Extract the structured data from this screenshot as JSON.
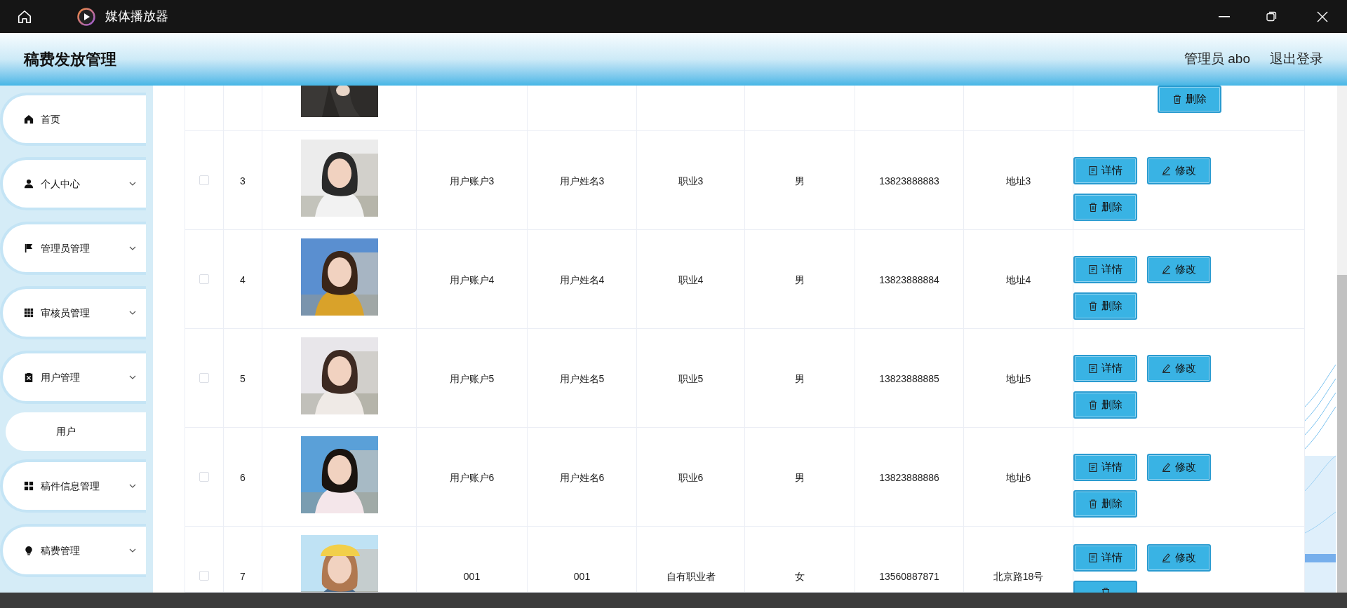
{
  "player": {
    "title": "媒体播放器"
  },
  "app": {
    "title": "稿费发放管理",
    "user": "管理员 abo",
    "logout": "退出登录"
  },
  "sidebar": {
    "items": [
      {
        "label": "首页",
        "kind": "home",
        "expandable": false
      },
      {
        "label": "个人中心",
        "kind": "person",
        "expandable": true
      },
      {
        "label": "管理员管理",
        "kind": "flag",
        "expandable": true
      },
      {
        "label": "审核员管理",
        "kind": "grid9",
        "expandable": true
      },
      {
        "label": "用户管理",
        "kind": "clipboard",
        "expandable": true,
        "children": [
          {
            "label": "用户"
          }
        ]
      },
      {
        "label": "稿件信息管理",
        "kind": "grid4",
        "expandable": true
      },
      {
        "label": "稿费管理",
        "kind": "bulb",
        "expandable": true
      }
    ]
  },
  "table": {
    "rows": [
      {
        "partial": true,
        "actions": [
          {
            "kind": "delete",
            "label": "删除"
          }
        ]
      },
      {
        "checked": false,
        "index": "3",
        "account": "用户账户3",
        "name": "用户姓名3",
        "job": "职业3",
        "gender": "男",
        "phone": "13823888883",
        "address": "地址3",
        "actions": [
          {
            "kind": "detail",
            "label": "详情"
          },
          {
            "kind": "edit",
            "label": "修改"
          },
          {
            "kind": "delete",
            "label": "删除"
          }
        ]
      },
      {
        "checked": false,
        "index": "4",
        "account": "用户账户4",
        "name": "用户姓名4",
        "job": "职业4",
        "gender": "男",
        "phone": "13823888884",
        "address": "地址4",
        "actions": [
          {
            "kind": "detail",
            "label": "详情"
          },
          {
            "kind": "edit",
            "label": "修改"
          },
          {
            "kind": "delete",
            "label": "删除"
          }
        ]
      },
      {
        "checked": false,
        "index": "5",
        "account": "用户账户5",
        "name": "用户姓名5",
        "job": "职业5",
        "gender": "男",
        "phone": "13823888885",
        "address": "地址5",
        "actions": [
          {
            "kind": "detail",
            "label": "详情"
          },
          {
            "kind": "edit",
            "label": "修改"
          },
          {
            "kind": "delete",
            "label": "删除"
          }
        ]
      },
      {
        "checked": false,
        "index": "6",
        "account": "用户账户6",
        "name": "用户姓名6",
        "job": "职业6",
        "gender": "男",
        "phone": "13823888886",
        "address": "地址6",
        "actions": [
          {
            "kind": "detail",
            "label": "详情"
          },
          {
            "kind": "edit",
            "label": "修改"
          },
          {
            "kind": "delete",
            "label": "删除"
          }
        ]
      },
      {
        "checked": false,
        "index": "7",
        "account": "001",
        "name": "001",
        "job": "自有职业者",
        "gender": "女",
        "phone": "13560887871",
        "address": "北京路18号",
        "actions": [
          {
            "kind": "detail",
            "label": "详情"
          },
          {
            "kind": "edit",
            "label": "修改"
          },
          {
            "kind": "delete"
          }
        ]
      }
    ]
  }
}
